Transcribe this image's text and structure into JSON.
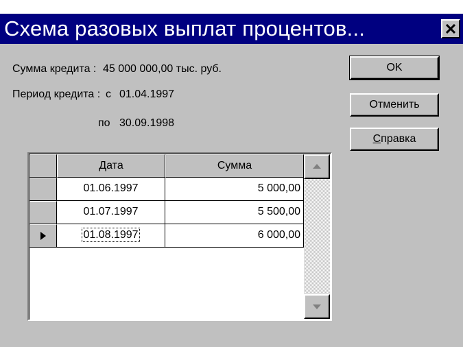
{
  "window": {
    "title": "Схема разовых выплат процентов..."
  },
  "info": {
    "amount_label": "Сумма кредита :",
    "amount_value": "45 000 000,00 тыс. руб.",
    "period_label": "Период кредита :",
    "from_prefix": "с",
    "from_date": "01.04.1997",
    "to_prefix": "по",
    "to_date": "30.09.1998"
  },
  "buttons": {
    "ok": "OK",
    "cancel": "Отменить",
    "help_mnemonic": "С",
    "help_rest": "правка"
  },
  "grid": {
    "columns": [
      "Дата",
      "Сумма"
    ],
    "rows": [
      {
        "date": "01.06.1997",
        "amount": "5 000,00"
      },
      {
        "date": "01.07.1997",
        "amount": "5 500,00"
      },
      {
        "date": "01.08.1997",
        "amount": "6 000,00"
      }
    ],
    "current_row_index": 2
  },
  "icons": {
    "close": "close-icon",
    "row_pointer": "triangle-right-icon",
    "scroll_up": "arrow-up-icon",
    "scroll_down": "arrow-down-icon"
  },
  "colors": {
    "titlebar": "#000080",
    "face": "#c0c0c0",
    "title_text": "#ffffff"
  }
}
